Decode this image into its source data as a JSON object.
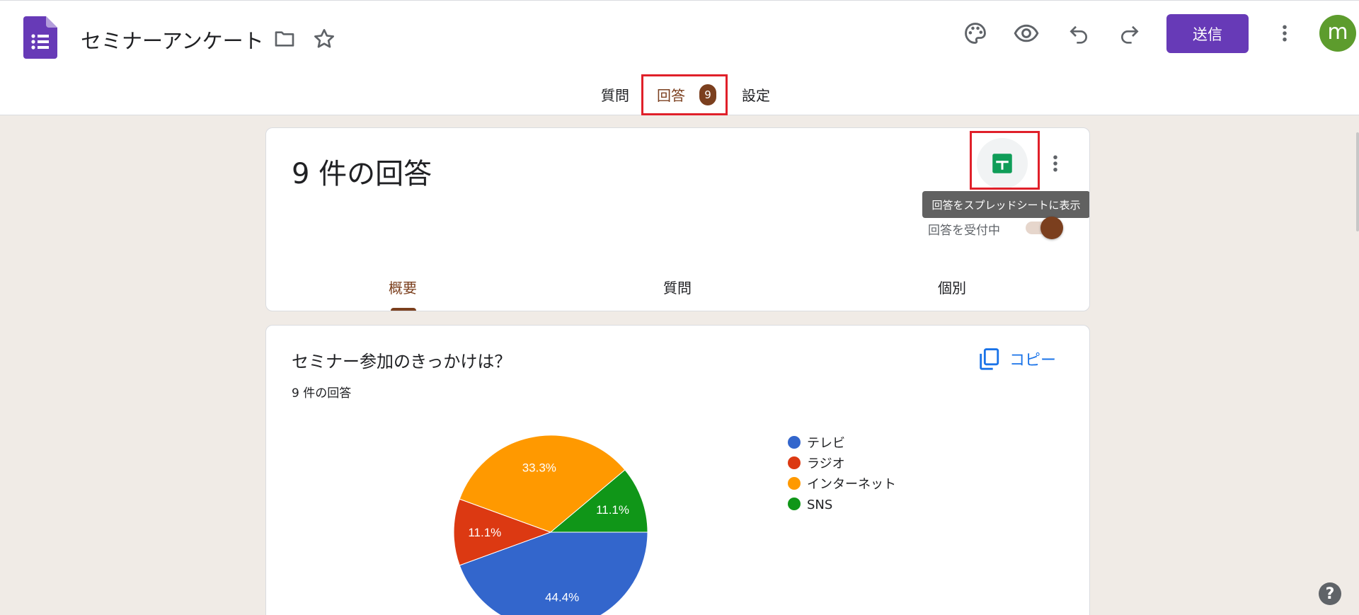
{
  "header": {
    "title": "セミナーアンケート",
    "send_label": "送信",
    "avatar_letter": "m",
    "accent": "#673ab7"
  },
  "main_tabs": [
    {
      "label": "質問"
    },
    {
      "label": "回答",
      "badge": "9",
      "active": true
    },
    {
      "label": "設定"
    }
  ],
  "summary": {
    "title": "9 件の回答",
    "tooltip": "回答をスプレッドシートに表示",
    "accepting_label": "回答を受付中",
    "accepting_on": true,
    "sub_tabs": [
      {
        "label": "概要",
        "active": true
      },
      {
        "label": "質問"
      },
      {
        "label": "個別"
      }
    ]
  },
  "question": {
    "title": "セミナー参加のきっかけは？",
    "count_label": "9 件の回答",
    "copy_label": "コピー"
  },
  "chart_data": {
    "type": "pie",
    "title": "",
    "categories": [
      "テレビ",
      "ラジオ",
      "インターネット",
      "SNS"
    ],
    "values": [
      44.4,
      11.1,
      33.3,
      11.1
    ],
    "colors": [
      "#3366cc",
      "#dc3912",
      "#ff9900",
      "#109618"
    ],
    "labels": [
      "44.4%",
      "11.1%",
      "33.3%",
      "11.1%"
    ],
    "legend_position": "right"
  },
  "icons": {
    "help": "?"
  }
}
